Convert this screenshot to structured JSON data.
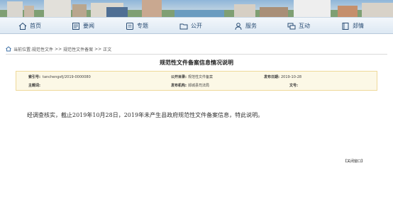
{
  "nav": {
    "items": [
      {
        "label": "首页",
        "icon": "home-icon"
      },
      {
        "label": "要闻",
        "icon": "news-icon"
      },
      {
        "label": "专题",
        "icon": "topic-icon"
      },
      {
        "label": "公开",
        "icon": "folder-icon"
      },
      {
        "label": "服务",
        "icon": "user-icon"
      },
      {
        "label": "互动",
        "icon": "chat-icon"
      },
      {
        "label": "郯情",
        "icon": "book-icon"
      }
    ]
  },
  "breadcrumb": {
    "prefix": "当前位置:",
    "items": [
      "规范性文件",
      "规范性文件备案",
      "正文"
    ],
    "separator": ">>"
  },
  "title": "规范性文件备案信息情况说明",
  "info": {
    "index_label": "索引号:",
    "index_value": "tanchengsfj/2019-0000080",
    "form_label": "公开目录:",
    "form_value": "规范性文件备案",
    "date_label": "发布日期:",
    "date_value": "2019-10-28",
    "subject_label": "主题词:",
    "subject_value": "",
    "org_label": "发布机构:",
    "org_value": "郯城县司法局",
    "docno_label": "文号:",
    "docno_value": ""
  },
  "body_text": "经调查核实，截止2019年10月28日，2019年未产生县政府规范性文件备案信息，特此说明。",
  "close_label": "【关闭窗口】",
  "colors": {
    "nav_text": "#2a4d74",
    "info_bg": "#fcf8e6",
    "info_border": "#efd99a"
  }
}
